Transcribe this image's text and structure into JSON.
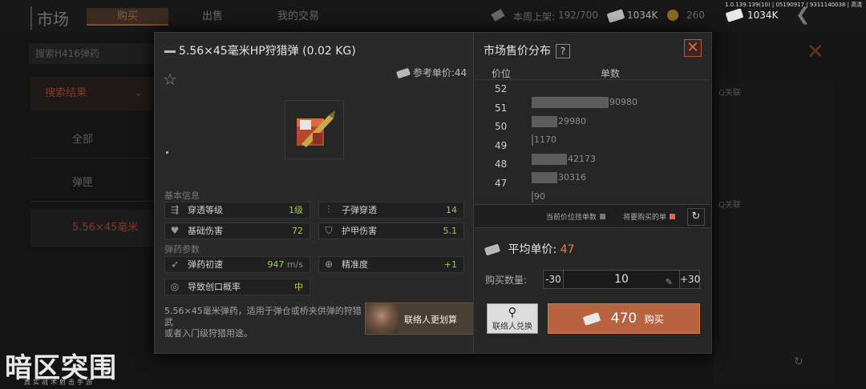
{
  "top": {
    "version": "1.0.139.139(10) | 05190917 | 9311140038 | 高清",
    "title": "市场",
    "tabs": [
      "购买",
      "出售",
      "我的交易"
    ],
    "listing_label": "本周上架:",
    "listing_value": "192/700",
    "cash_1": "1034K",
    "coins": "260",
    "cash_2": "1034K"
  },
  "sidebar": {
    "search": "搜索H416弹药",
    "results": "搜索结果",
    "items": [
      "全部",
      "弹匣",
      "5.56×45毫米"
    ]
  },
  "bg_buttons": [
    "Q关联",
    "Q关联"
  ],
  "brand": {
    "name": "暗区突围",
    "sub": "真实战术射击手游"
  },
  "dialog": {
    "item_title": "5.56×45毫米HP狩猎弹 (0.02 KG)",
    "ref_price": "参考单价:44",
    "section_basic": "基本信息",
    "section_ammo": "弹药参数",
    "stats": {
      "penetration_level": {
        "label": "穿透等级",
        "value": "1级"
      },
      "bullet_pen": {
        "label": "子弹穿透",
        "value": "14"
      },
      "base_damage": {
        "label": "基础伤害",
        "value": "72"
      },
      "armor_damage": {
        "label": "护甲伤害",
        "value": "5.1"
      },
      "muzzle_velocity": {
        "label": "弹药初速",
        "value": "947",
        "unit": "m/s"
      },
      "accuracy": {
        "label": "精准度",
        "value": "+1"
      },
      "wound_chance": {
        "label": "导致创口概率",
        "value": "中"
      }
    },
    "description_1": "5.56×45毫米弹药，适用于弹仓或桥夹供弹的狩猎武",
    "description_2": "或者入门级狩猎用途。",
    "contact": {
      "label": "联络人更划算",
      "search_label": "联络人兑换"
    }
  },
  "market": {
    "title": "市场售价分布",
    "help": "?",
    "close": "✕",
    "col_price": "价位",
    "col_qty": "单数",
    "legend_current": "当前价位挂单数",
    "legend_buy": "将要购买的单",
    "refresh": "↻",
    "avg_label": "平均单价:",
    "avg_value": "47",
    "qty_label": "购买数量:",
    "qty_minus": "-30",
    "qty_value": "10",
    "qty_plus": "+30",
    "buy_total": "470",
    "buy_label": "购买"
  },
  "chart_data": {
    "type": "bar",
    "orientation": "horizontal",
    "categories": [
      "52",
      "51",
      "50",
      "49",
      "48",
      "47"
    ],
    "values": [
      90980,
      29980,
      1170,
      42173,
      30316,
      90
    ],
    "xlabel": "单数",
    "ylabel": "价位"
  }
}
